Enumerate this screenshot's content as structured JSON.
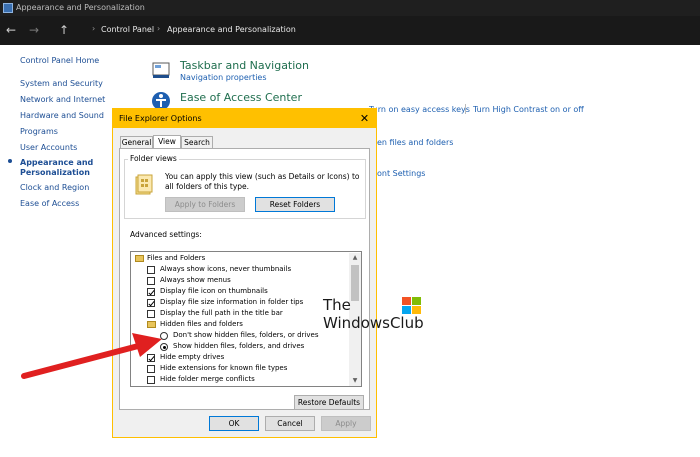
{
  "window": {
    "title": "Appearance and Personalization"
  },
  "address": {
    "back": "←",
    "forward": "→",
    "up": "↑",
    "separator": "›",
    "crumbs": [
      "Control Panel",
      "Appearance and Personalization"
    ]
  },
  "sidebar": {
    "items": [
      "Control Panel Home",
      "System and Security",
      "Network and Internet",
      "Hardware and Sound",
      "Programs",
      "User Accounts",
      "Appearance and",
      "Personalization",
      "Clock and Region",
      "Ease of Access"
    ]
  },
  "main": {
    "taskbar": {
      "heading": "Taskbar and Navigation",
      "link": "Navigation properties"
    },
    "ease": {
      "heading": "Ease of Access Center",
      "link1": "Turn on easy access keys",
      "link2": "Turn High Contrast on or off"
    },
    "partial1": "en files and folders",
    "partial2": "ont Settings"
  },
  "dialog": {
    "title": "File Explorer Options",
    "close": "✕",
    "tabs": [
      "General",
      "View",
      "Search"
    ],
    "folder_views": {
      "label": "Folder views",
      "desc": "You can apply this view (such as Details or Icons) to all folders of this type.",
      "apply_button": "Apply to Folders",
      "reset_button": "Reset Folders"
    },
    "advanced": {
      "label": "Advanced settings:",
      "items": [
        {
          "text": "Files and Folders",
          "type": "folder"
        },
        {
          "text": "Always show icons, never thumbnails",
          "type": "checkbox",
          "checked": false
        },
        {
          "text": "Always show menus",
          "type": "checkbox",
          "checked": false
        },
        {
          "text": "Display file icon on thumbnails",
          "type": "checkbox",
          "checked": true
        },
        {
          "text": "Display file size information in folder tips",
          "type": "checkbox",
          "checked": true
        },
        {
          "text": "Display the full path in the title bar",
          "type": "checkbox",
          "checked": false
        },
        {
          "text": "Hidden files and folders",
          "type": "folder"
        },
        {
          "text": "Don't show hidden files, folders, or drives",
          "type": "radio",
          "checked": false
        },
        {
          "text": "Show hidden files, folders, and drives",
          "type": "radio",
          "checked": true
        },
        {
          "text": "Hide empty drives",
          "type": "checkbox",
          "checked": true
        },
        {
          "text": "Hide extensions for known file types",
          "type": "checkbox",
          "checked": false
        },
        {
          "text": "Hide folder merge conflicts",
          "type": "checkbox",
          "checked": false
        }
      ]
    },
    "restore_button": "Restore Defaults",
    "ok": "OK",
    "cancel": "Cancel",
    "apply": "Apply"
  },
  "watermark": {
    "line1": "The",
    "line2": "WindowsClub"
  },
  "colors": {
    "dialog_title": "#ffc000",
    "arrow": "#e02020",
    "link": "#1d5fb0",
    "heading": "#1f6e4e"
  }
}
